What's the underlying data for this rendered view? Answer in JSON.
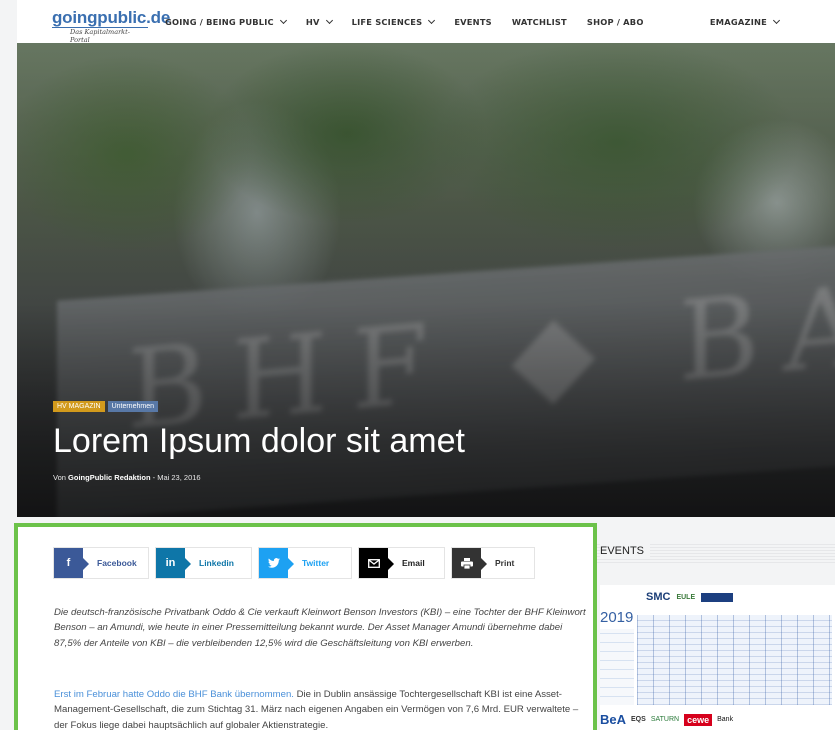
{
  "header": {
    "logo_main": "goingpublic.de",
    "logo_sub": "Das Kapitalmarkt-Portal",
    "nav": [
      {
        "label": "GOING / BEING PUBLIC",
        "dropdown": true
      },
      {
        "label": "HV",
        "dropdown": true
      },
      {
        "label": "LIFE SCIENCES",
        "dropdown": true
      },
      {
        "label": "EVENTS",
        "dropdown": false
      },
      {
        "label": "WATCHLIST",
        "dropdown": false
      },
      {
        "label": "SHOP / ABO",
        "dropdown": false
      }
    ],
    "nav_right": {
      "label": "EMAGAZINE",
      "dropdown": true
    }
  },
  "hero": {
    "tags": [
      "HV MAGAZIN",
      "Unternehmen"
    ],
    "title": "Lorem Ipsum dolor sit amet",
    "byline_prefix": "Von",
    "author": "GoingPublic Redaktion",
    "date": "- Mai 23, 2016"
  },
  "share": {
    "facebook": "Facebook",
    "linkedin": "Linkedin",
    "twitter": "Twitter",
    "email": "Email",
    "print": "Print"
  },
  "article": {
    "intro": "Die deutsch-französische Privatbank Oddo & Cie verkauft Kleinwort Benson Investors (KBI) – eine Tochter der BHF Kleinwort Benson – an Amundi, wie heute in einer Pressemitteilung bekannt wurde. Der Asset Manager Amundi übernehme dabei 87,5% der Anteile von KBI – die verbleibenden 12,5% wird die Geschäftsleitung von KBI erwerben.",
    "link_text": "Erst im Februar hatte Oddo die BHF Bank übernommen.",
    "body": " Die in Dublin ansässige  Tochtergesellschaft KBI ist eine Asset-Management-Gesellschaft, die zum Stichtag 31. März nach eigenen Angaben ein Vermögen von 7,6 Mrd. EUR verwaltete – der Fokus liege dabei hauptsächlich auf globaler Aktienstrategie."
  },
  "sidebar": {
    "events_title": "EVENTS",
    "calendar": {
      "smc": "SMC",
      "eule": "EULE",
      "year": "2019",
      "logos": [
        "BeA",
        "EQS",
        "SATURN",
        "cewe",
        "Bank"
      ]
    }
  },
  "colors": {
    "accent_green": "#6cc24a",
    "link_blue": "#4a90d9",
    "tag_gold": "#d29a1c",
    "tag_blue": "#5878a6"
  }
}
